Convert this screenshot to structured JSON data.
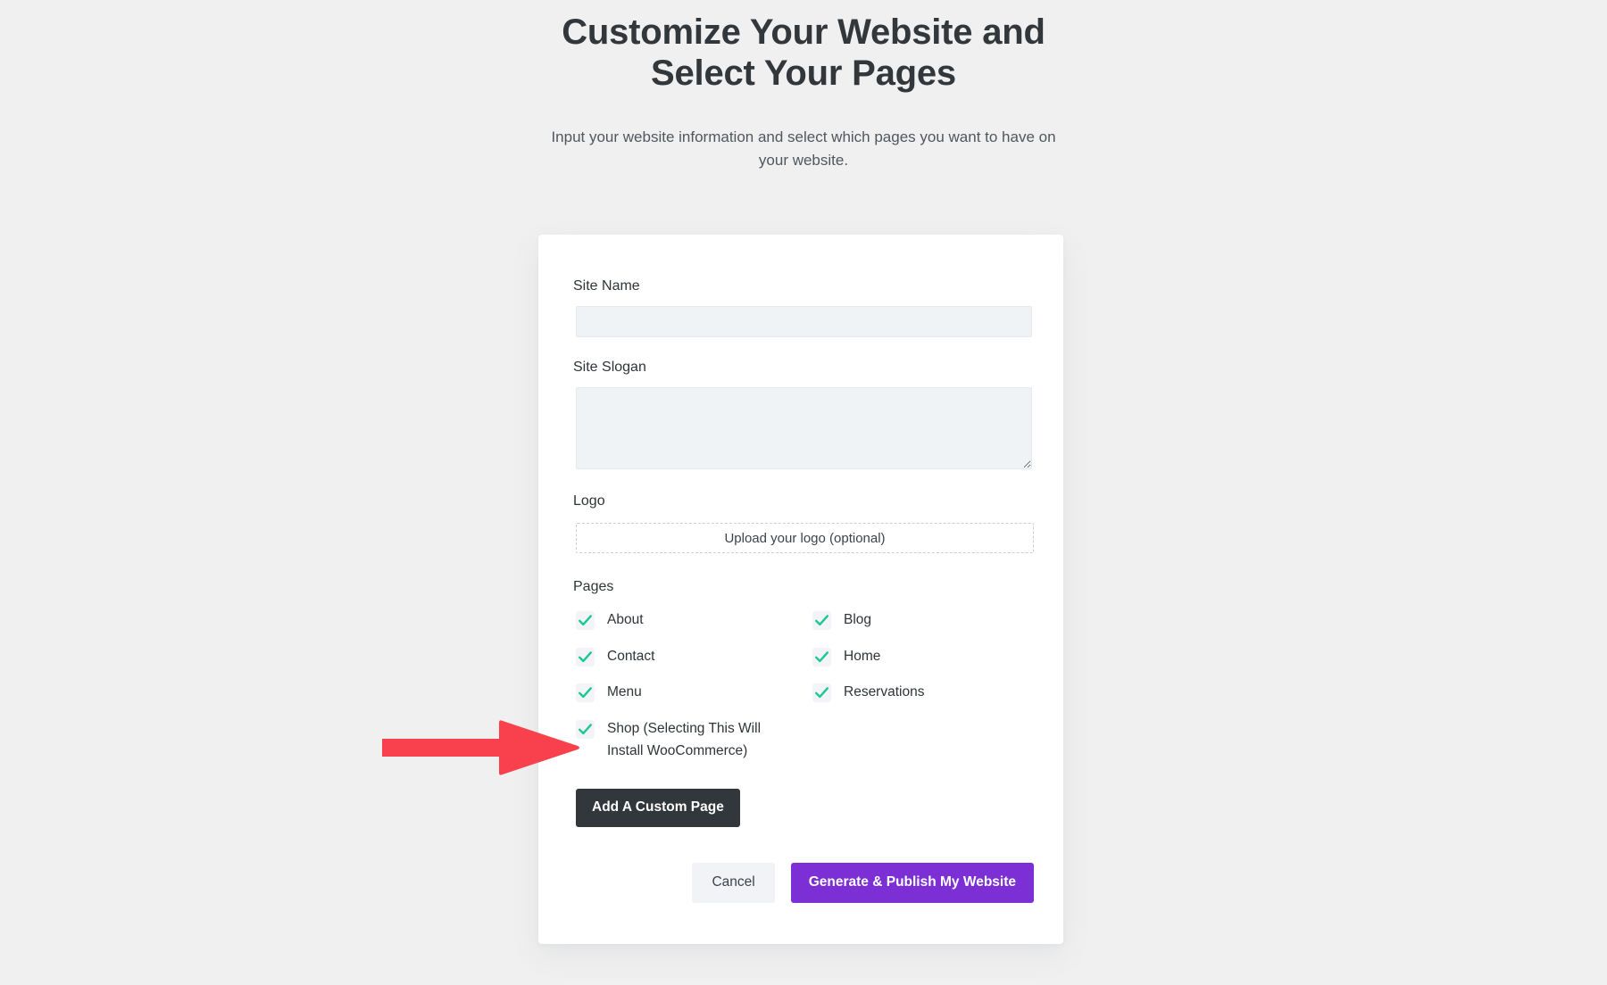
{
  "header": {
    "title_line1": "Customize Your Website and",
    "title_line2": "Select Your Pages",
    "subtitle": "Input your website information and select which pages you want to have on your website."
  },
  "form": {
    "site_name": {
      "label": "Site Name",
      "value": "",
      "placeholder": ""
    },
    "site_slogan": {
      "label": "Site Slogan",
      "value": "",
      "placeholder": ""
    },
    "logo": {
      "label": "Logo",
      "upload_text": "Upload your logo (optional)"
    },
    "pages": {
      "label": "Pages",
      "items": [
        {
          "label": "About",
          "checked": true
        },
        {
          "label": "Blog",
          "checked": true
        },
        {
          "label": "Contact",
          "checked": true
        },
        {
          "label": "Home",
          "checked": true
        },
        {
          "label": "Menu",
          "checked": true
        },
        {
          "label": "Reservations",
          "checked": true
        },
        {
          "label": "Shop (Selecting This Will Install WooCommerce)",
          "checked": true
        }
      ]
    },
    "add_custom_page_label": "Add A Custom Page"
  },
  "actions": {
    "cancel_label": "Cancel",
    "publish_label": "Generate & Publish My Website"
  },
  "annotation": {
    "type": "arrow-right",
    "color": "#f9404d",
    "points_to": "Shop (Selecting This Will Install WooCommerce)"
  },
  "colors": {
    "page_background": "#f0f0f0",
    "card_background": "#ffffff",
    "input_background": "#eff3f6",
    "check_green": "#1bc98e",
    "checkbox_box": "#f2f4f7",
    "primary_button": "#7b2fd4",
    "dark_button": "#32373c",
    "cancel_button": "#f1f3f6",
    "arrow_red": "#f9404d",
    "title_text": "#32373c",
    "body_text": "#50575e"
  }
}
